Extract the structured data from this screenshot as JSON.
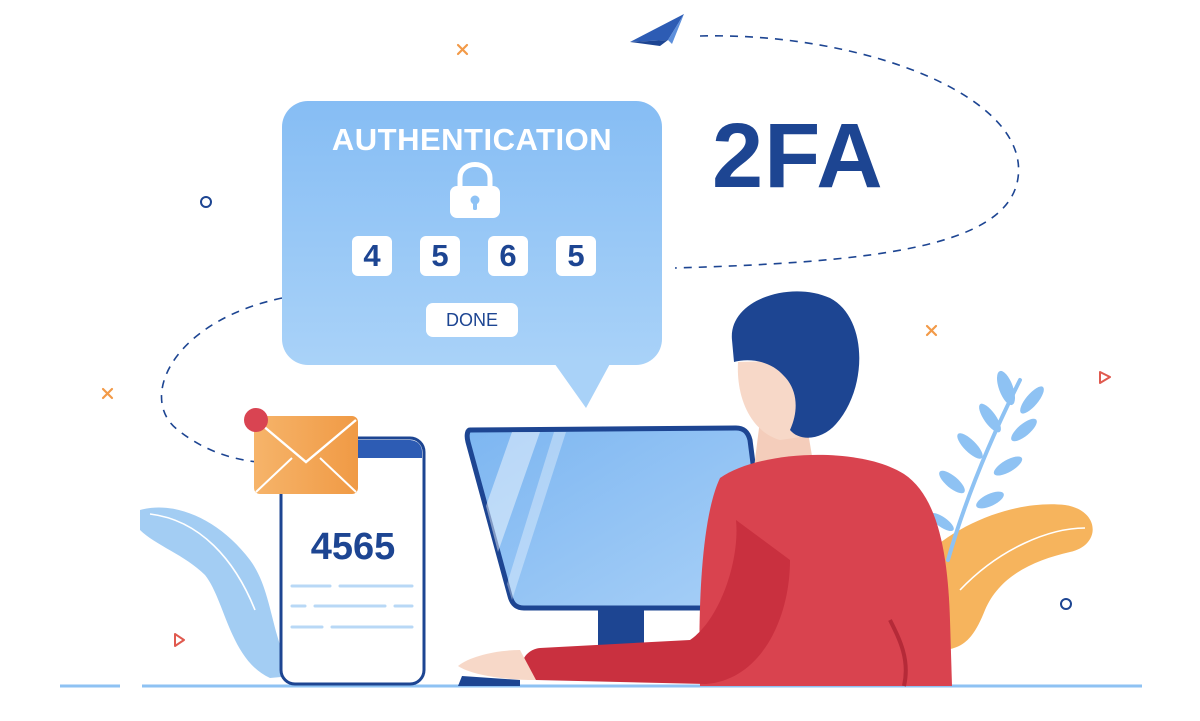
{
  "headline": {
    "text": "2FA"
  },
  "auth_card": {
    "title": "AUTHENTICATION",
    "icon": "lock-icon",
    "digits": [
      "4",
      "5",
      "6",
      "5"
    ],
    "done_label": "DONE"
  },
  "phone": {
    "code": "4565",
    "notification_icon": "envelope-icon"
  },
  "colors": {
    "navy": "#1d4592",
    "card_blue": "#8ec2f5",
    "sweater_red": "#d9434f",
    "envelope_orange": "#f4a04b",
    "leaf_blue": "#9ccaf2",
    "background": "#ffffff"
  }
}
